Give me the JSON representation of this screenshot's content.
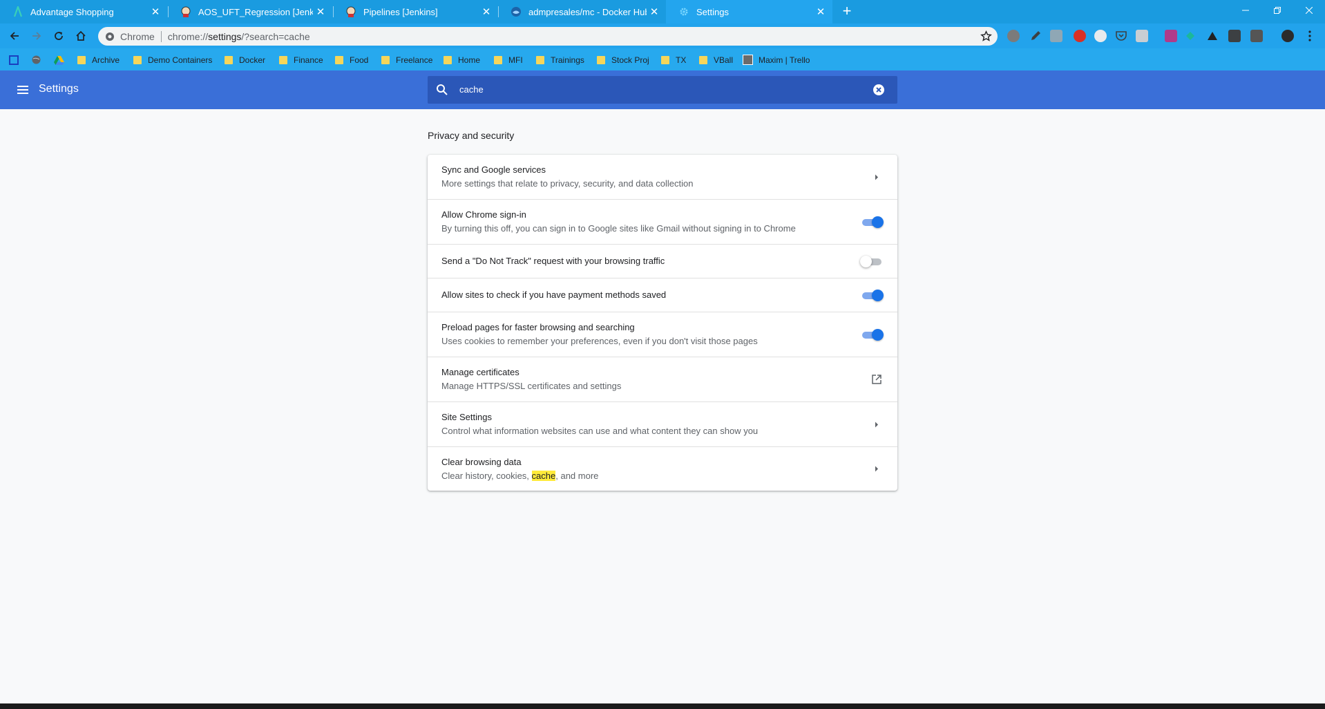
{
  "browser": {
    "tabs": [
      {
        "title": "Advantage Shopping",
        "icon": "advantage-logo-icon",
        "active": false
      },
      {
        "title": "AOS_UFT_Regression [Jenkins]",
        "icon": "jenkins-icon",
        "active": false
      },
      {
        "title": "Pipelines [Jenkins]",
        "icon": "jenkins-icon",
        "active": false
      },
      {
        "title": "admpresales/mc - Docker Hub",
        "icon": "docker-icon",
        "active": false
      },
      {
        "title": "Settings",
        "icon": "gear-icon",
        "active": true
      }
    ],
    "new_tab_label": "+",
    "omnibox": {
      "scheme": "Chrome",
      "url_prefix": "chrome://",
      "url_host": "settings",
      "url_rest": "/?search=cache"
    },
    "bookmarks": [
      {
        "label": "Archive"
      },
      {
        "label": "Demo Containers"
      },
      {
        "label": "Docker"
      },
      {
        "label": "Finance"
      },
      {
        "label": "Food"
      },
      {
        "label": "Freelance"
      },
      {
        "label": "Home"
      },
      {
        "label": "MFI"
      },
      {
        "label": "Trainings"
      },
      {
        "label": "Stock Proj"
      },
      {
        "label": "TX"
      },
      {
        "label": "VBall"
      },
      {
        "label": "Maxim | Trello"
      }
    ]
  },
  "settings": {
    "title": "Settings",
    "search_value": "cache",
    "section_title": "Privacy and security",
    "rows": [
      {
        "label": "Sync and Google services",
        "sub": "More settings that relate to privacy, security, and data collection",
        "control": "arrow"
      },
      {
        "label": "Allow Chrome sign-in",
        "sub": "By turning this off, you can sign in to Google sites like Gmail without signing in to Chrome",
        "control": "toggle-on"
      },
      {
        "label": "Send a \"Do Not Track\" request with your browsing traffic",
        "sub": "",
        "control": "toggle-off"
      },
      {
        "label": "Allow sites to check if you have payment methods saved",
        "sub": "",
        "control": "toggle-on"
      },
      {
        "label": "Preload pages for faster browsing and searching",
        "sub": "Uses cookies to remember your preferences, even if you don't visit those pages",
        "control": "toggle-on"
      },
      {
        "label": "Manage certificates",
        "sub": "Manage HTTPS/SSL certificates and settings",
        "control": "external"
      },
      {
        "label": "Site Settings",
        "sub": "Control what information websites can use and what content they can show you",
        "control": "arrow"
      },
      {
        "label": "Clear browsing data",
        "sub_before": "Clear history, cookies, ",
        "sub_highlight": "cache",
        "sub_after": ", and more",
        "control": "arrow"
      }
    ]
  },
  "colors": {
    "tabstrip": "#1a9be0",
    "settings_header": "#3a6fd8",
    "toggle_on": "#1a73e8",
    "highlight": "#ffeb3b"
  }
}
